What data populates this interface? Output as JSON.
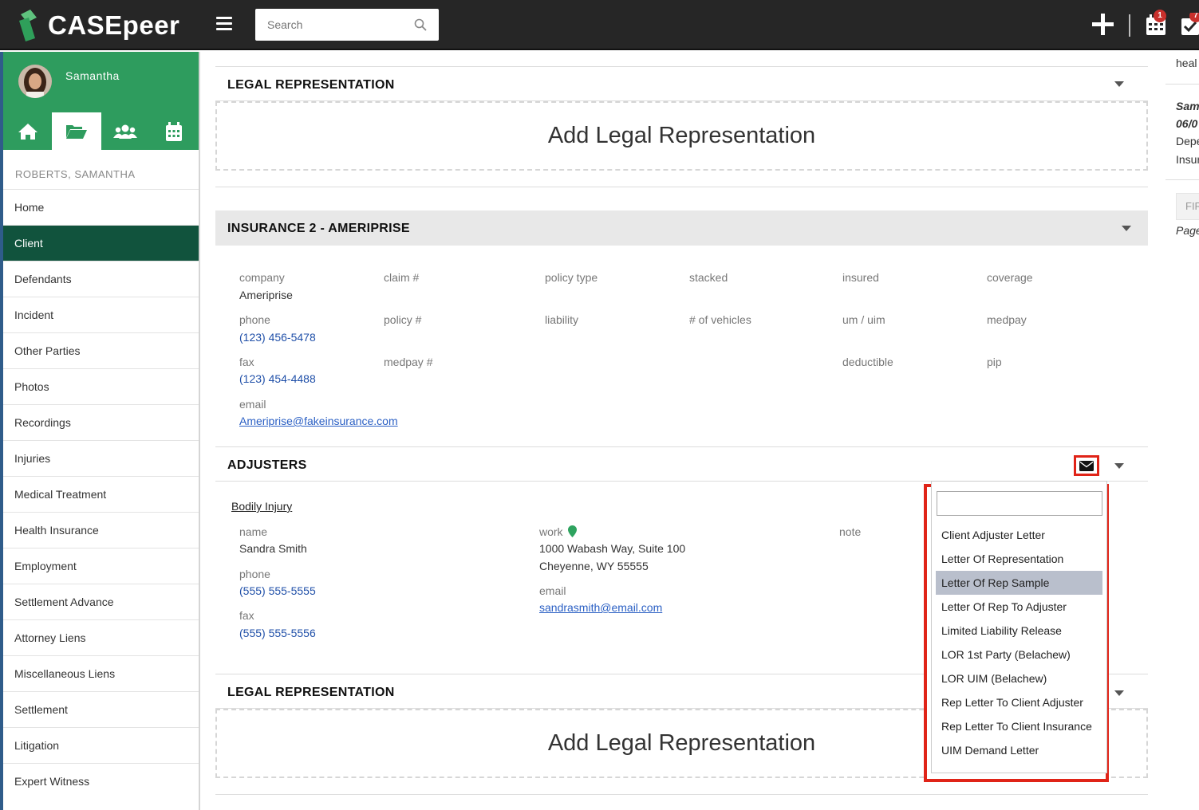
{
  "app": {
    "logo_text": "CASEpeer"
  },
  "topbar": {
    "search_placeholder": "Search",
    "calendar_badge": "1",
    "tasks_badge": "7"
  },
  "sidebar": {
    "user_name": "Samantha",
    "client_name": "ROBERTS, SAMANTHA",
    "items": [
      {
        "label": "Home"
      },
      {
        "label": "Client"
      },
      {
        "label": "Defendants"
      },
      {
        "label": "Incident"
      },
      {
        "label": "Other Parties"
      },
      {
        "label": "Photos"
      },
      {
        "label": "Recordings"
      },
      {
        "label": "Injuries"
      },
      {
        "label": "Medical Treatment"
      },
      {
        "label": "Health Insurance"
      },
      {
        "label": "Employment"
      },
      {
        "label": "Settlement Advance"
      },
      {
        "label": "Attorney Liens"
      },
      {
        "label": "Miscellaneous Liens"
      },
      {
        "label": "Settlement"
      },
      {
        "label": "Litigation"
      },
      {
        "label": "Expert Witness"
      }
    ],
    "active_item": "Client"
  },
  "main": {
    "legal_rep_title": "LEGAL REPRESENTATION",
    "add_legal_rep": "Add Legal Representation",
    "insurance_title": "INSURANCE 2 - AMERIPRISE",
    "insurance": {
      "labels": {
        "company": "company",
        "claim": "claim #",
        "policy_type": "policy type",
        "stacked": "stacked",
        "insured": "insured",
        "coverage": "coverage",
        "phone": "phone",
        "policy": "policy #",
        "liability": "liability",
        "vehicles": "# of vehicles",
        "um_uim": "um / uim",
        "medpay": "medpay",
        "fax": "fax",
        "medpay_num": "medpay #",
        "deductible": "deductible",
        "pip": "pip",
        "email": "email"
      },
      "company": "Ameriprise",
      "phone": "(123) 456-5478",
      "fax": "(123) 454-4488",
      "email": "Ameriprise@fakeinsurance.com"
    },
    "adjusters_title": "ADJUSTERS",
    "adjuster": {
      "type": "Bodily Injury",
      "labels": {
        "name": "name",
        "phone": "phone",
        "fax": "fax",
        "work": "work",
        "email": "email",
        "note": "note"
      },
      "name": "Sandra Smith",
      "phone": "(555) 555-5555",
      "fax": "(555) 555-5556",
      "address_line1": "1000 Wabash Way, Suite 100",
      "address_line2": "Cheyenne, WY 55555",
      "email": "sandrasmith@email.com"
    }
  },
  "dropdown": {
    "search_value": "",
    "items": [
      "Client Adjuster Letter",
      "Letter Of Representation",
      "Letter Of Rep Sample",
      "Letter Of Rep To Adjuster",
      "Limited Liability Release",
      "LOR 1st Party (Belachew)",
      "LOR UIM (Belachew)",
      "Rep Letter To Client Adjuster",
      "Rep Letter To Client Insurance",
      "UIM Demand Letter"
    ],
    "highlighted": "Letter Of Rep Sample"
  },
  "right_panel": {
    "line1": "heal",
    "line2": "Sam",
    "line3": "06/0",
    "line4": "Depe",
    "line5": "Insur",
    "line6": "FIR",
    "line7": "Page"
  },
  "colors": {
    "brand_green": "#2e9c5e",
    "active_nav": "#11533d",
    "highlight": "#e02418",
    "link": "#1f4fa8"
  }
}
